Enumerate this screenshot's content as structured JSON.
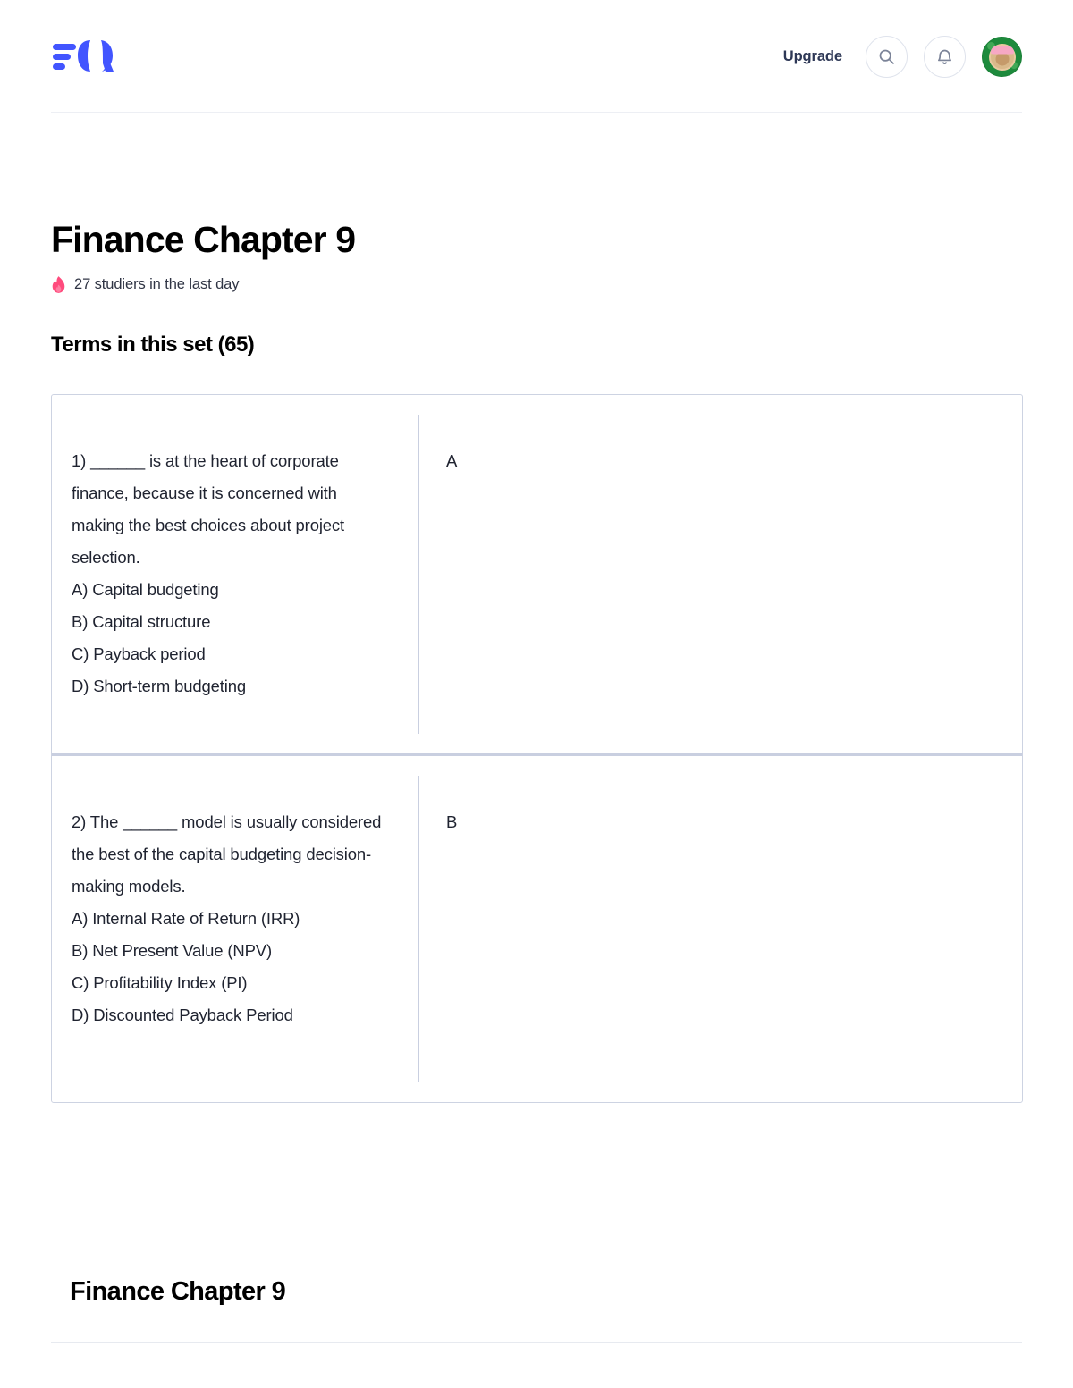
{
  "header": {
    "logo_name": "quizlet-logo",
    "upgrade_label": "Upgrade",
    "search_icon": "search-icon",
    "notifications_icon": "bell-icon",
    "avatar_label": "user-avatar"
  },
  "set": {
    "title": "Finance Chapter 9",
    "studiers_icon": "flame-icon",
    "studiers_text": "27 studiers in the last day",
    "terms_heading": "Terms in this set (65)"
  },
  "terms": [
    {
      "term": "1) ______ is at the heart of corporate finance, because it is concerned with making the best choices about project selection.\nA) Capital budgeting\nB) Capital structure\nC) Payback period\nD) Short-term budgeting",
      "definition": "A"
    },
    {
      "term": "2) The ______ model is usually considered the best of the capital budgeting decision-making models.\nA) Internal Rate of Return (IRR)\nB) Net Present Value (NPV)\nC) Profitability Index (PI)\nD) Discounted Payback Period",
      "definition": "B"
    }
  ],
  "footer": {
    "title": "Finance Chapter 9"
  },
  "colors": {
    "brand_blue": "#4255ff",
    "flame_pink": "#ff4b7d",
    "text_dark": "#2e3856",
    "border": "#cdd3e2",
    "avatar_green": "#1d8a3c"
  }
}
